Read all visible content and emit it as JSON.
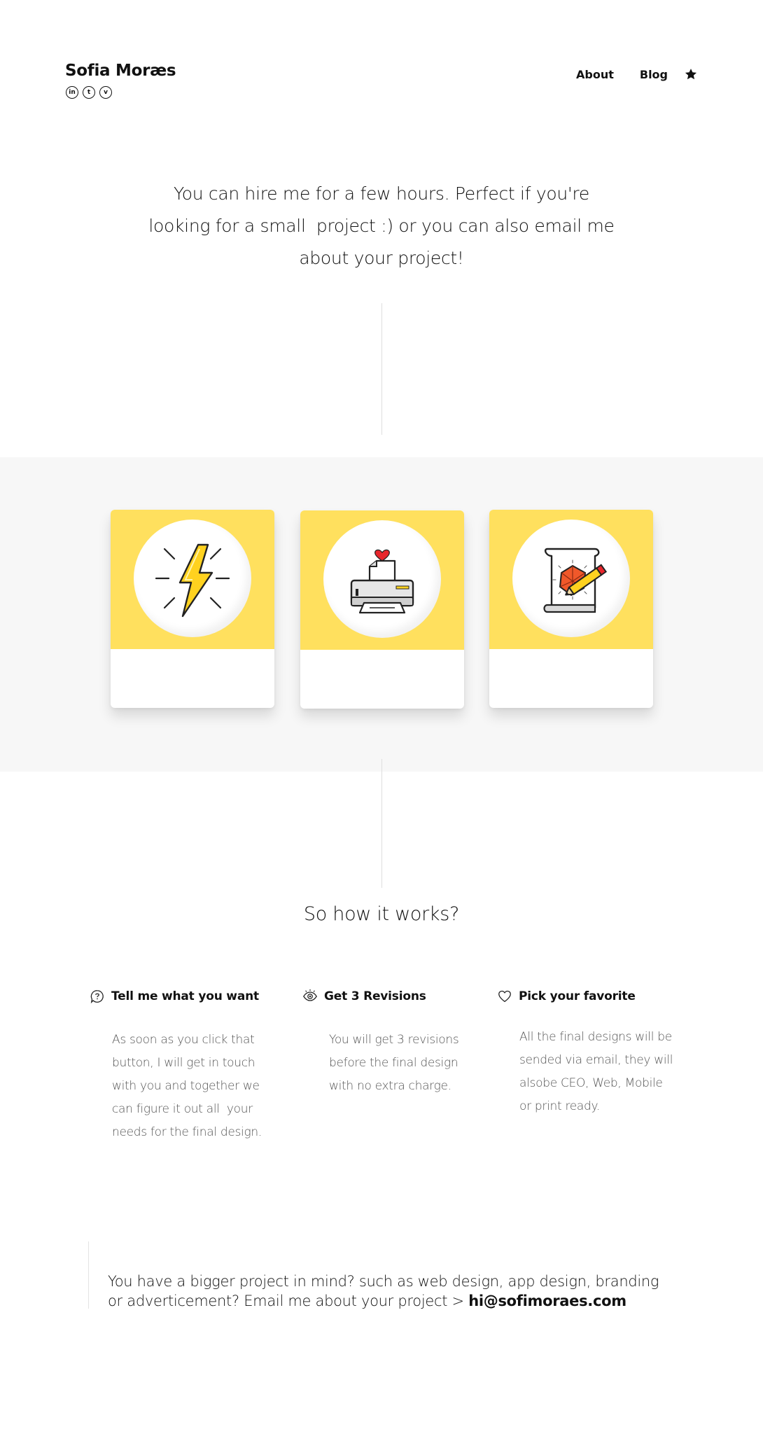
{
  "header": {
    "brand": "Sofia Moræs",
    "socials": [
      {
        "icon": "linkedin-icon",
        "glyph": "in"
      },
      {
        "icon": "tumblr-icon",
        "glyph": "t"
      },
      {
        "icon": "vimeo-icon",
        "glyph": "v"
      }
    ],
    "nav": {
      "about": "About",
      "blog": "Blog",
      "star_icon": "star-icon"
    }
  },
  "intro": {
    "line1": "You can hire me for a few hours. Perfect if you're",
    "line2": "looking for a small  project :) or you can also email me",
    "line3": "about your project!"
  },
  "cards": [
    {
      "icon": "lightning-bolt-icon"
    },
    {
      "icon": "printer-heart-icon"
    },
    {
      "icon": "scroll-pencil-icon"
    }
  ],
  "how": {
    "title": "So how it works?",
    "steps": [
      {
        "icon": "chat-question-icon",
        "title": "Tell me what you want",
        "text": "As soon as you click that\nbutton, I will get in touch\nwith you and together we\ncan figure it out all  your\nneeds for the final design."
      },
      {
        "icon": "eye-icon",
        "title": "Get 3 Revisions",
        "text": "You will get 3 revisions\nbefore the final design\nwith no extra charge."
      },
      {
        "icon": "heart-icon",
        "title": "Pick your favorite",
        "text": "All the final designs will be\nsended via email, they will\nalsobe CEO, Web, Mobile\nor print ready."
      }
    ]
  },
  "bottom": {
    "line1": "You have a bigger project in mind?  such as web design, app design, branding",
    "line2": "or adverticement? Email me about your project > ",
    "email": "hi@sofimoraes.com"
  },
  "colors": {
    "accent_yellow": "#ffe05e",
    "band_grey": "#f7f7f7",
    "text": "#111111",
    "muted_text": "#555555"
  }
}
